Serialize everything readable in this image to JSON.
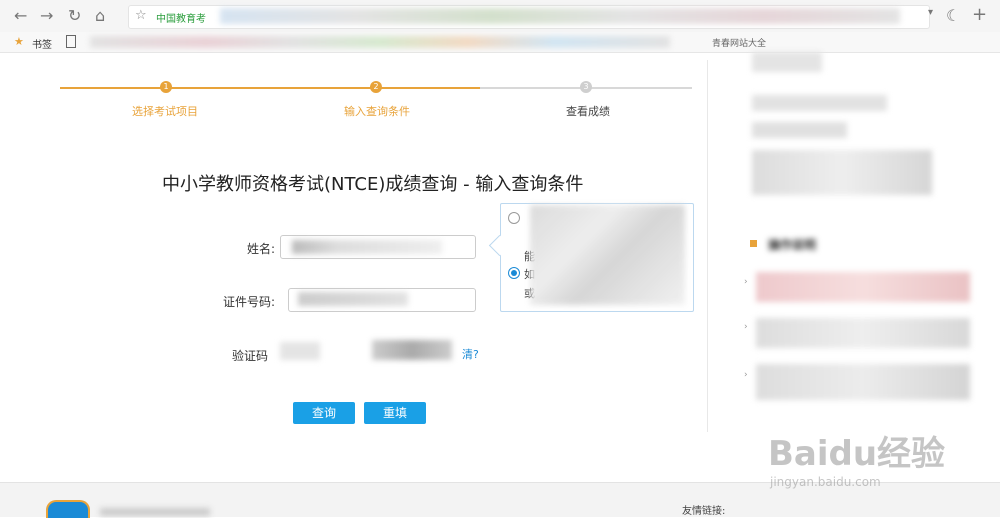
{
  "browser": {
    "url_text": "中国教育考",
    "bookmarks_label": "书签",
    "bookmark_right": "青春网站大全"
  },
  "steps": [
    {
      "number": "1",
      "label": "选择考试项目"
    },
    {
      "number": "2",
      "label": "输入查询条件"
    },
    {
      "number": "3",
      "label": "查看成绩"
    }
  ],
  "form": {
    "title": "中小学教师资格考试(NTCE)成绩查询 - 输入查询条件",
    "name_label": "姓名:",
    "id_label": "证件号码:",
    "captcha_label": "验证码",
    "captcha_link": "清?",
    "submit_label": "查询",
    "reset_label": "重填"
  },
  "popup": {
    "line1": "能",
    "line2": "如",
    "line3": "或"
  },
  "sidebar": {
    "heading": "操作说明"
  },
  "footer": {
    "links_label": "友情链接:"
  },
  "watermark": {
    "brand": "Baidu经验",
    "url": "jingyan.baidu.com"
  },
  "colors": {
    "step_active": "#e8a33a",
    "step_inactive": "#cfcfcf",
    "button": "#1aa0e6"
  }
}
